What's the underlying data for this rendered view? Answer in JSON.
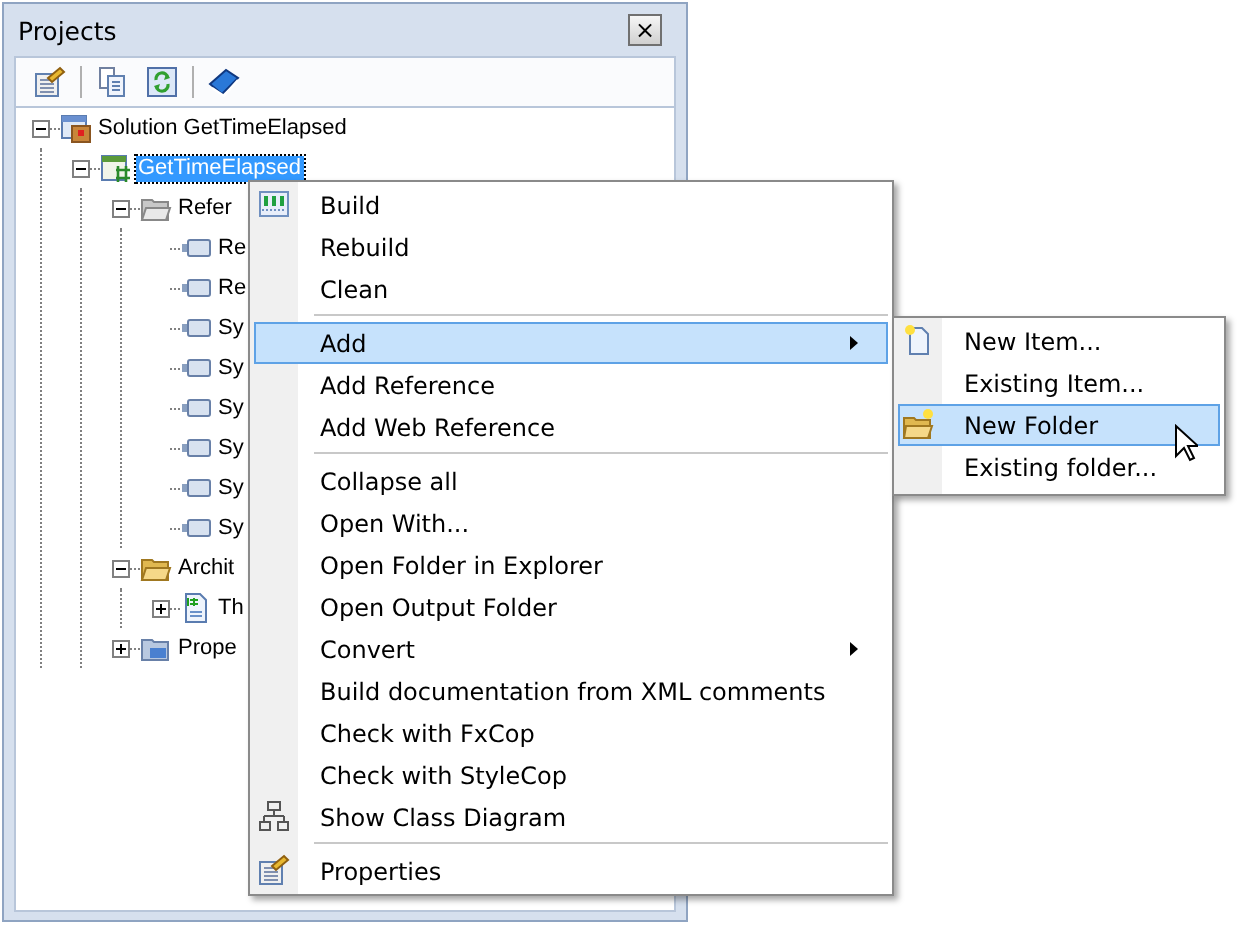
{
  "panel": {
    "title": "Projects",
    "close": "×"
  },
  "tree": [
    {
      "label": "Solution GetTimeElapsed",
      "kind": "solution",
      "expanded": true,
      "selected": false,
      "children": [
        {
          "label": "GetTimeElapsed",
          "kind": "project",
          "expanded": true,
          "selected": true,
          "children": [
            {
              "label": "Refer",
              "kind": "folder",
              "expanded": true,
              "selected": false,
              "children": [
                {
                  "label": "Re",
                  "kind": "reference",
                  "selected": false
                },
                {
                  "label": "Re",
                  "kind": "reference",
                  "selected": false
                },
                {
                  "label": "Sy",
                  "kind": "reference",
                  "selected": false
                },
                {
                  "label": "Sy",
                  "kind": "reference",
                  "selected": false
                },
                {
                  "label": "Sy",
                  "kind": "reference",
                  "selected": false
                },
                {
                  "label": "Sy",
                  "kind": "reference",
                  "selected": false
                },
                {
                  "label": "Sy",
                  "kind": "reference",
                  "selected": false
                },
                {
                  "label": "Sy",
                  "kind": "reference",
                  "selected": false
                }
              ]
            },
            {
              "label": "Archit",
              "kind": "openfolder",
              "expanded": true,
              "selected": false,
              "children": [
                {
                  "label": "Th",
                  "kind": "file",
                  "expanded": false,
                  "selected": false
                }
              ]
            },
            {
              "label": "Prope",
              "kind": "properties",
              "expanded": false,
              "selected": false
            }
          ]
        }
      ]
    }
  ],
  "context_menu": [
    {
      "kind": "item",
      "label": "Build",
      "selected": false
    },
    {
      "kind": "item",
      "label": "Rebuild",
      "selected": false
    },
    {
      "kind": "item",
      "label": "Clean",
      "selected": false
    },
    {
      "kind": "separator"
    },
    {
      "kind": "submenu",
      "label": "Add",
      "selected": true
    },
    {
      "kind": "item",
      "label": "Add Reference",
      "selected": false
    },
    {
      "kind": "item",
      "label": "Add Web Reference",
      "selected": false
    },
    {
      "kind": "separator"
    },
    {
      "kind": "item",
      "label": "Collapse all",
      "selected": false
    },
    {
      "kind": "item",
      "label": "Open With...",
      "selected": false
    },
    {
      "kind": "item",
      "label": "Open Folder in Explorer",
      "selected": false
    },
    {
      "kind": "item",
      "label": "Open Output Folder",
      "selected": false
    },
    {
      "kind": "submenu",
      "label": "Convert",
      "selected": false
    },
    {
      "kind": "item",
      "label": "Build documentation from XML comments",
      "selected": false
    },
    {
      "kind": "item",
      "label": "Check with FxCop",
      "selected": false
    },
    {
      "kind": "item",
      "label": "Check with StyleCop",
      "selected": false
    },
    {
      "kind": "item",
      "label": "Show Class Diagram",
      "selected": false
    },
    {
      "kind": "separator"
    },
    {
      "kind": "item",
      "label": "Properties",
      "selected": false
    }
  ],
  "submenu": [
    {
      "label": "New Item...",
      "selected": false
    },
    {
      "label": "Existing Item...",
      "selected": false
    },
    {
      "label": "New Folder",
      "selected": true
    },
    {
      "label": "Existing folder...",
      "selected": false
    }
  ]
}
